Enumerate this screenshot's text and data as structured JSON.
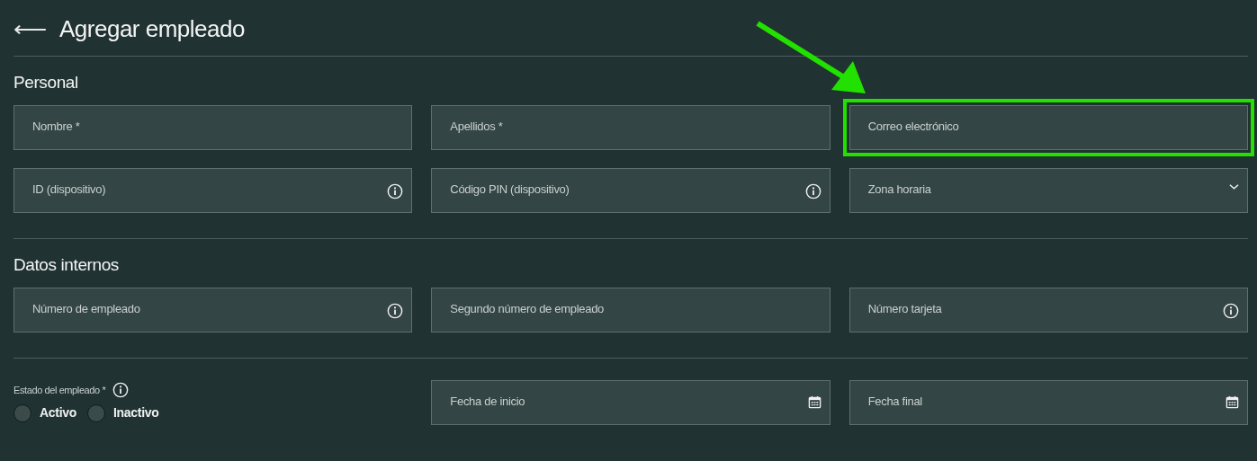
{
  "header": {
    "back": "⟵",
    "title": "Agregar empleado"
  },
  "sections": [
    {
      "title": "Personal",
      "fields": [
        {
          "label": "Nombre *",
          "kind": "text",
          "highlighted": false
        },
        {
          "label": "Apellidos *",
          "kind": "text",
          "highlighted": false
        },
        {
          "label": "Correo electrónico",
          "kind": "text",
          "highlighted": true
        },
        {
          "label": "ID (dispositivo)",
          "kind": "info",
          "highlighted": false
        },
        {
          "label": "Código PIN (dispositivo)",
          "kind": "info",
          "highlighted": false
        },
        {
          "label": "Zona horaria",
          "kind": "select",
          "highlighted": false
        }
      ]
    },
    {
      "title": "Datos internos",
      "fields": [
        {
          "label": "Número de empleado",
          "kind": "info",
          "highlighted": false
        },
        {
          "label": "Segundo número de empleado",
          "kind": "text",
          "highlighted": false
        },
        {
          "label": "Número tarjeta",
          "kind": "info",
          "highlighted": false
        }
      ]
    }
  ],
  "status": {
    "label": "Estado del empleado *",
    "options": [
      {
        "label": "Activo",
        "selected": false
      },
      {
        "label": "Inactivo",
        "selected": false
      }
    ]
  },
  "dates": [
    {
      "label": "Fecha de inicio",
      "kind": "date",
      "highlighted": false
    },
    {
      "label": "Fecha final",
      "kind": "date",
      "highlighted": false
    }
  ]
}
